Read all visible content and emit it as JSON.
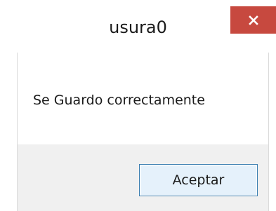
{
  "window": {
    "title": "usura0",
    "close_icon": "close-icon"
  },
  "colors": {
    "close_button_bg": "#c7493f",
    "button_panel_bg": "#f0f0f0",
    "ok_button_border": "#3c7fb1"
  },
  "content": {
    "message": "Se Guardo correctamente"
  },
  "buttons": {
    "ok_label": "Aceptar"
  }
}
